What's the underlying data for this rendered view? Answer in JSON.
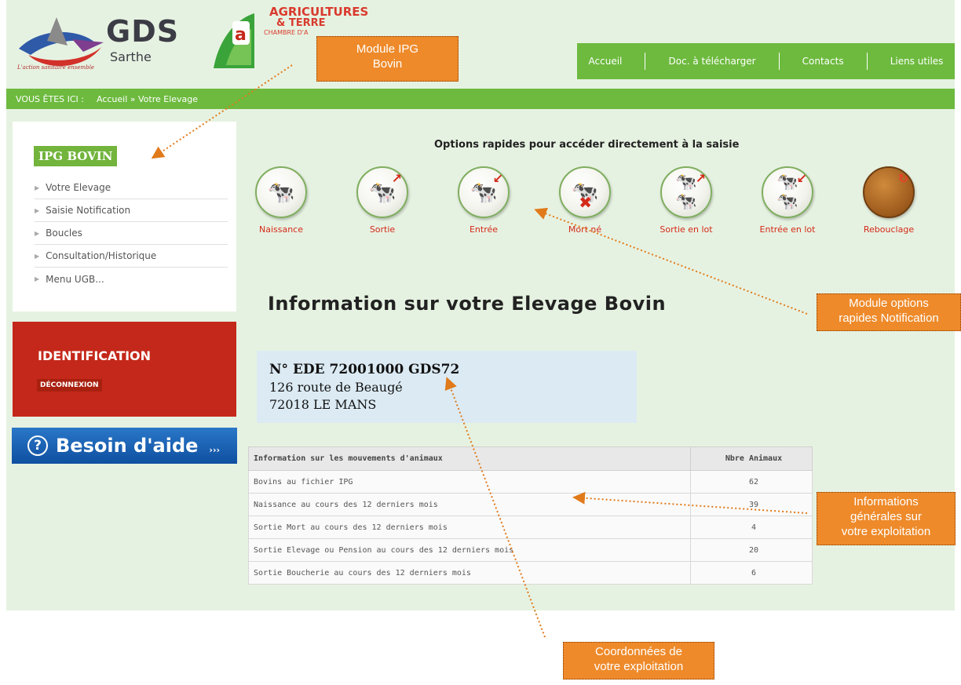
{
  "header": {
    "gds_name": "GDS",
    "gds_sub": "Sarthe",
    "gds_tagline": "L'action sanitaire ensemble",
    "agri_title": "AGRICULTURES",
    "agri_sub": "& TERRE",
    "agri_small": "CHAMBRE D'A"
  },
  "topnav": [
    "Accueil",
    "Doc. à télécharger",
    "Contacts",
    "Liens utiles"
  ],
  "breadcrumb": {
    "label": "VOUS ÊTES ICI :",
    "path": "Accueil » Votre Elevage"
  },
  "sidebar": {
    "title": "IPG BOVIN",
    "items": [
      "Votre Elevage",
      "Saisie Notification",
      "Boucles",
      "Consultation/Historique",
      "Menu UGB..."
    ],
    "ident_title": "IDENTIFICATION",
    "logout": "DÉCONNEXION",
    "help_label": "Besoin d'aide",
    "help_dots": "›››"
  },
  "quick": {
    "title": "Options rapides pour accéder directement à la saisie",
    "options": [
      {
        "label": "Naissance",
        "icon": "calf-icon"
      },
      {
        "label": "Sortie",
        "icon": "cow-exit-icon"
      },
      {
        "label": "Entrée",
        "icon": "cow-entry-icon"
      },
      {
        "label": "Mort né",
        "icon": "stillborn-icon"
      },
      {
        "label": "Sortie en lot",
        "icon": "herd-exit-icon"
      },
      {
        "label": "Entrée en lot",
        "icon": "herd-entry-icon"
      },
      {
        "label": "Rebouclage",
        "icon": "ear-tag-icon"
      }
    ]
  },
  "main": {
    "title": "Information sur votre Elevage Bovin",
    "ede": "N° EDE 72001000  GDS72",
    "address1": "126 route de Beaugé",
    "address2": "72018 LE MANS"
  },
  "table": {
    "headers": [
      "Information sur les mouvements d'animaux",
      "Nbre Animaux"
    ],
    "rows": [
      [
        "Bovins au fichier IPG",
        "62"
      ],
      [
        "Naissance au cours des 12 derniers mois",
        "39"
      ],
      [
        "Sortie Mort au cours des 12 derniers mois",
        "4"
      ],
      [
        "Sortie Elevage ou Pension au cours des 12 derniers mois",
        "20"
      ],
      [
        "Sortie Boucherie au cours des 12 derniers mois",
        "6"
      ]
    ]
  },
  "annotations": {
    "module_ipg_1": "Module IPG",
    "module_ipg_2": "Bovin",
    "module_options_1": "Module options",
    "module_options_2": "rapides Notification",
    "infos_1": "Informations",
    "infos_2": "générales sur",
    "infos_3": "votre exploitation",
    "coords_1": "Coordonnées de",
    "coords_2": "votre exploitation"
  },
  "colors": {
    "accent_green": "#6dba3e",
    "ident_red": "#c4281a",
    "help_blue": "#1a5fb0",
    "callout_orange": "#ee8a2a"
  }
}
